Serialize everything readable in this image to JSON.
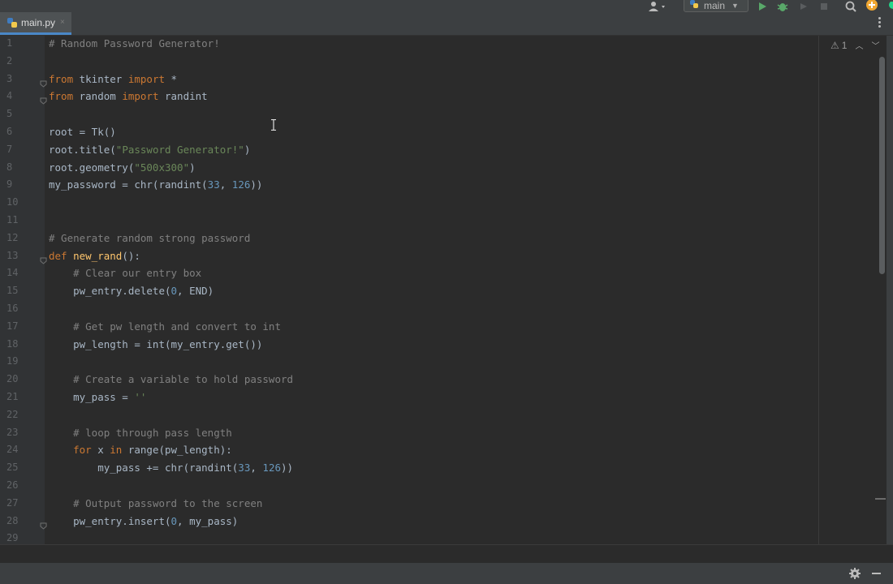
{
  "toolbar": {
    "branch": "main",
    "icons": [
      "user-icon",
      "python-icon",
      "run-icon",
      "debug-icon",
      "coverage-icon",
      "stop-icon",
      "search-icon",
      "update-icon"
    ]
  },
  "tabs": [
    {
      "label": "main.py",
      "close": "×",
      "icon": "python-file-icon",
      "active": true
    }
  ],
  "inspections": {
    "warnings": "1",
    "icon": "warning-icon"
  },
  "colors": {
    "background": "#2b2b2b",
    "keyword": "#cc7832",
    "string": "#6a8759",
    "number": "#6897bb",
    "comment": "#808080",
    "function_def": "#ffc66d",
    "plain": "#a9b7c6",
    "run_green": "#59a869",
    "update_orange": "#f0a732"
  },
  "lines": [
    {
      "n": "1",
      "fold": false,
      "tokens": [
        [
          "c",
          "# Random Password Generator!"
        ]
      ]
    },
    {
      "n": "2",
      "fold": false,
      "tokens": []
    },
    {
      "n": "3",
      "fold": true,
      "tokens": [
        [
          "k",
          "from"
        ],
        [
          "p",
          " tkinter "
        ],
        [
          "k",
          "import"
        ],
        [
          "p",
          " *"
        ]
      ]
    },
    {
      "n": "4",
      "fold": true,
      "tokens": [
        [
          "k",
          "from"
        ],
        [
          "p",
          " random "
        ],
        [
          "k",
          "import"
        ],
        [
          "p",
          " randint"
        ]
      ]
    },
    {
      "n": "5",
      "fold": false,
      "tokens": []
    },
    {
      "n": "6",
      "fold": false,
      "tokens": [
        [
          "p",
          "root = Tk()"
        ]
      ]
    },
    {
      "n": "7",
      "fold": false,
      "tokens": [
        [
          "p",
          "root.title("
        ],
        [
          "s",
          "\"Password Generator!\""
        ],
        [
          "p",
          ")"
        ]
      ]
    },
    {
      "n": "8",
      "fold": false,
      "tokens": [
        [
          "p",
          "root.geometry("
        ],
        [
          "s",
          "\"500x300\""
        ],
        [
          "p",
          ")"
        ]
      ]
    },
    {
      "n": "9",
      "fold": false,
      "tokens": [
        [
          "p",
          "my_password = chr(randint("
        ],
        [
          "n",
          "33"
        ],
        [
          "p",
          ", "
        ],
        [
          "n",
          "126"
        ],
        [
          "p",
          "))"
        ]
      ]
    },
    {
      "n": "10",
      "fold": false,
      "tokens": []
    },
    {
      "n": "11",
      "fold": false,
      "tokens": []
    },
    {
      "n": "12",
      "fold": false,
      "tokens": [
        [
          "c",
          "# Generate random strong password"
        ]
      ]
    },
    {
      "n": "13",
      "fold": true,
      "tokens": [
        [
          "k",
          "def"
        ],
        [
          "p",
          " "
        ],
        [
          "f",
          "new_rand"
        ],
        [
          "p",
          "():"
        ]
      ]
    },
    {
      "n": "14",
      "fold": false,
      "tokens": [
        [
          "p",
          "    "
        ],
        [
          "c",
          "# Clear our entry box"
        ]
      ]
    },
    {
      "n": "15",
      "fold": false,
      "tokens": [
        [
          "p",
          "    pw_entry.delete("
        ],
        [
          "n",
          "0"
        ],
        [
          "p",
          ", END)"
        ]
      ]
    },
    {
      "n": "16",
      "fold": false,
      "tokens": []
    },
    {
      "n": "17",
      "fold": false,
      "tokens": [
        [
          "p",
          "    "
        ],
        [
          "c",
          "# Get pw length and convert to int"
        ]
      ]
    },
    {
      "n": "18",
      "fold": false,
      "tokens": [
        [
          "p",
          "    pw_length = int(my_entry.get())"
        ]
      ]
    },
    {
      "n": "19",
      "fold": false,
      "tokens": []
    },
    {
      "n": "20",
      "fold": false,
      "tokens": [
        [
          "p",
          "    "
        ],
        [
          "c",
          "# Create a variable to hold password"
        ]
      ]
    },
    {
      "n": "21",
      "fold": false,
      "tokens": [
        [
          "p",
          "    my_pass = "
        ],
        [
          "s",
          "''"
        ]
      ]
    },
    {
      "n": "22",
      "fold": false,
      "tokens": []
    },
    {
      "n": "23",
      "fold": false,
      "tokens": [
        [
          "p",
          "    "
        ],
        [
          "c",
          "# loop through pass length"
        ]
      ]
    },
    {
      "n": "24",
      "fold": false,
      "tokens": [
        [
          "p",
          "    "
        ],
        [
          "k",
          "for"
        ],
        [
          "p",
          " x "
        ],
        [
          "k",
          "in"
        ],
        [
          "p",
          " range(pw_length):"
        ]
      ]
    },
    {
      "n": "25",
      "fold": false,
      "tokens": [
        [
          "p",
          "        my_pass += chr(randint("
        ],
        [
          "n",
          "33"
        ],
        [
          "p",
          ", "
        ],
        [
          "n",
          "126"
        ],
        [
          "p",
          "))"
        ]
      ]
    },
    {
      "n": "26",
      "fold": false,
      "tokens": []
    },
    {
      "n": "27",
      "fold": false,
      "tokens": [
        [
          "p",
          "    "
        ],
        [
          "c",
          "# Output password to the screen"
        ]
      ]
    },
    {
      "n": "28",
      "fold": true,
      "tokens": [
        [
          "p",
          "    pw_entry.insert("
        ],
        [
          "n",
          "0"
        ],
        [
          "p",
          ", my_pass)"
        ]
      ]
    },
    {
      "n": "29",
      "fold": false,
      "tokens": []
    }
  ]
}
